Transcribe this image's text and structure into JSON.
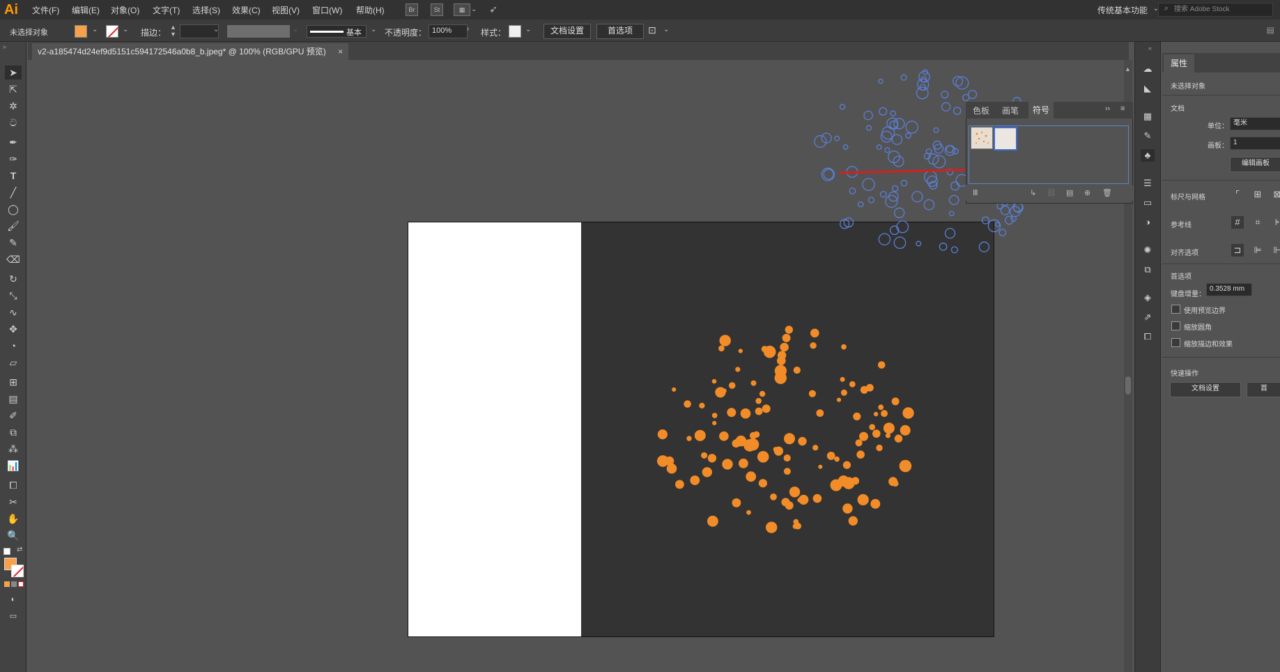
{
  "app": {
    "logo": "Ai"
  },
  "menu": [
    "文件(F)",
    "编辑(E)",
    "对象(O)",
    "文字(T)",
    "选择(S)",
    "效果(C)",
    "视图(V)",
    "窗口(W)",
    "帮助(H)"
  ],
  "menu_icons": {
    "bridge": "Br",
    "stock": "St"
  },
  "workspace": "传统基本功能",
  "search_placeholder": "搜索 Adobe Stock",
  "control": {
    "no_selection": "未选择对象",
    "stroke_label": "描边：",
    "brush_label": "基本",
    "opacity_label": "不透明度：",
    "opacity_value": "100%",
    "style_label": "样式：",
    "doc_setup": "文档设置",
    "prefs": "首选项"
  },
  "document_tab": "v2-a185474d24ef9d5151c594172546a0b8_b.jpeg* @ 100% (RGB/GPU 预览)",
  "document_tab_close": "×",
  "symbols_panel": {
    "tabs": [
      "色板",
      "画笔",
      "符号"
    ],
    "active_tab": "符号"
  },
  "properties": {
    "tab": "属性",
    "no_selection": "未选择对象",
    "document_header": "文档",
    "units_label": "单位：",
    "units_value": "毫米",
    "artboard_label": "画板：",
    "artboard_value": "1",
    "edit_artboards": "编辑画板",
    "rulers_grid": "标尺与网格",
    "guides": "参考线",
    "snap_options": "对齐选项",
    "preferences_header": "首选项",
    "keyboard_increment_label": "键盘增量：",
    "keyboard_increment_value": "0.3528 mm",
    "check_preview_bounds": "使用预览边界",
    "check_scale_corners": "缩放圆角",
    "check_scale_strokes": "缩放描边和效果",
    "quick_actions": "快速操作",
    "qa_doc_setup": "文档设置",
    "qa_prefs_partial": "首"
  },
  "colors": {
    "ui_dark": "#323232",
    "canvas": "#535353",
    "artboard_dark": "#333333",
    "accent_orange": "#f28c28",
    "selection_blue": "#5b7fd6",
    "arrow_red": "#d32020",
    "fill_swatch": "#f7a24b"
  }
}
